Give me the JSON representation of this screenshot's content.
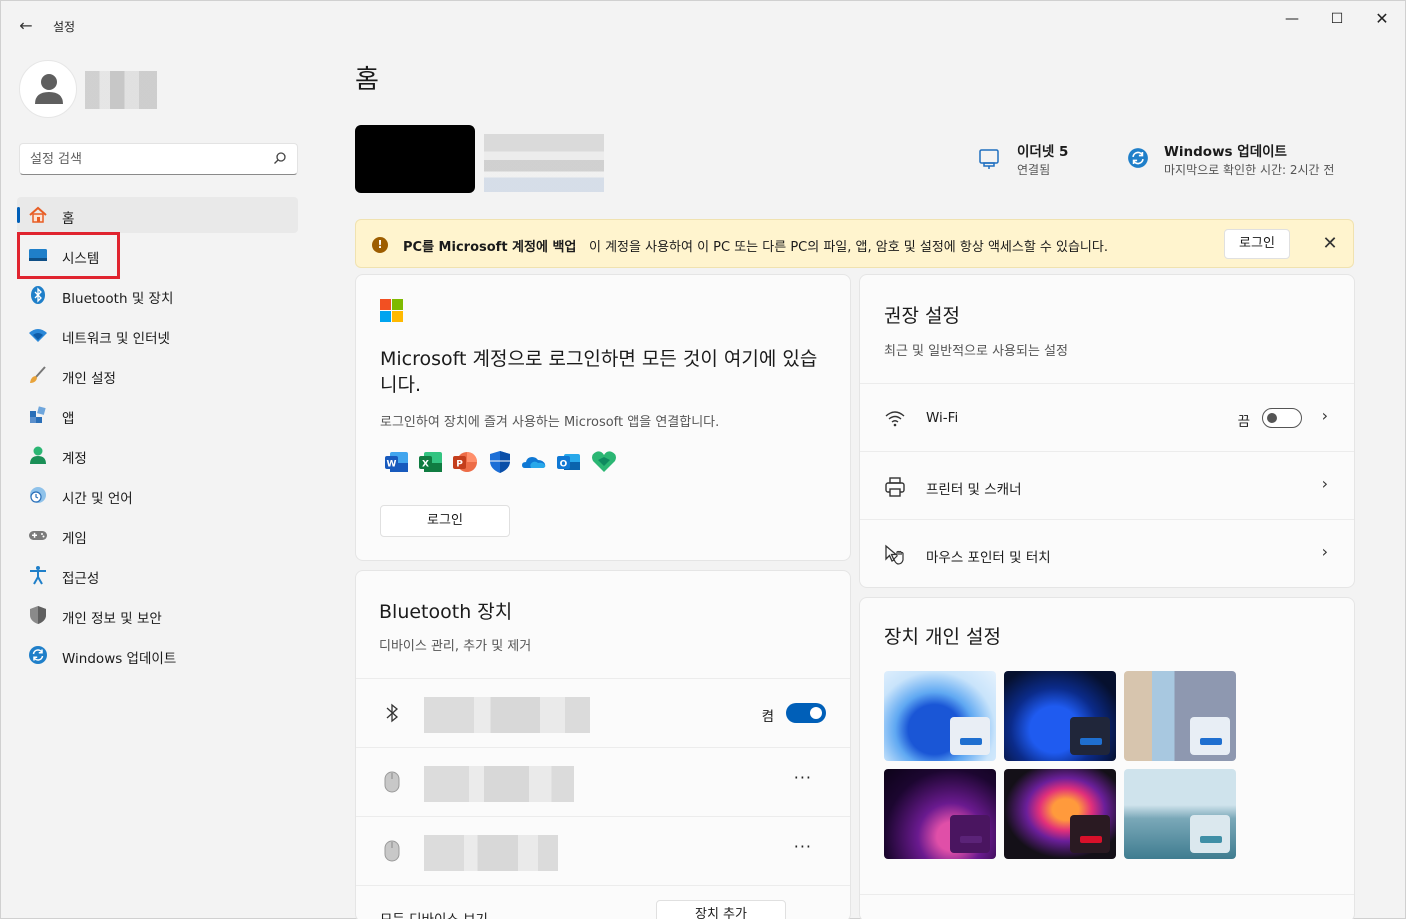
{
  "window": {
    "title": "설정",
    "back": "←",
    "minimize": "—",
    "maximize": "☐",
    "close": "✕"
  },
  "sidebar": {
    "search_placeholder": "설정 검색",
    "items": [
      {
        "label": "홈",
        "icon": "home-icon",
        "active": true
      },
      {
        "label": "시스템",
        "icon": "system-icon",
        "active": false
      },
      {
        "label": "Bluetooth 및 장치",
        "icon": "bluetooth-icon",
        "active": false
      },
      {
        "label": "네트워크 및 인터넷",
        "icon": "network-icon",
        "active": false
      },
      {
        "label": "개인 설정",
        "icon": "brush-icon",
        "active": false
      },
      {
        "label": "앱",
        "icon": "apps-icon",
        "active": false
      },
      {
        "label": "계정",
        "icon": "account-icon",
        "active": false
      },
      {
        "label": "시간 및 언어",
        "icon": "time-language-icon",
        "active": false
      },
      {
        "label": "게임",
        "icon": "gamepad-icon",
        "active": false
      },
      {
        "label": "접근성",
        "icon": "accessibility-icon",
        "active": false
      },
      {
        "label": "개인 정보 및 보안",
        "icon": "shield-icon",
        "active": false
      },
      {
        "label": "Windows 업데이트",
        "icon": "update-icon",
        "active": false
      }
    ]
  },
  "main": {
    "title": "홈",
    "status": {
      "ethernet_title": "이더넷 5",
      "ethernet_sub": "연결됨",
      "update_title": "Windows 업데이트",
      "update_sub": "마지막으로 확인한 시간: 2시간 전"
    },
    "banner": {
      "icon": "!",
      "title": "PC를 Microsoft 계정에 백업",
      "text": "이 계정을 사용하여 이 PC 또는 다른 PC의 파일, 앱, 암호 및 설정에 항상 액세스할 수 있습니다.",
      "button": "로그인",
      "close": "✕"
    },
    "signin_card": {
      "title": "Microsoft 계정으로 로그인하면 모든 것이 여기에 있습니다.",
      "desc": "로그인하여 장치에 즐겨 사용하는 Microsoft 앱을 연결합니다.",
      "apps": [
        "word-icon",
        "excel-icon",
        "powerpoint-icon",
        "defender-icon",
        "onedrive-icon",
        "outlook-icon",
        "family-icon"
      ],
      "button": "로그인"
    },
    "recommended": {
      "title": "권장 설정",
      "subtitle": "최근 및 일반적으로 사용되는 설정",
      "items": [
        {
          "label": "Wi-Fi",
          "icon": "wifi-icon",
          "toggle_label": "끔",
          "toggle_on": false
        },
        {
          "label": "프린터 및 스캐너",
          "icon": "printer-icon"
        },
        {
          "label": "마우스 포인터 및 터치",
          "icon": "pointer-icon"
        }
      ],
      "chevron": "›"
    },
    "bluetooth_card": {
      "title": "Bluetooth 장치",
      "subtitle": "디바이스 관리, 추가 및 제거",
      "toggle_label": "켬",
      "more": "···",
      "footer_label": "모든 디바이스 보기",
      "footer_button": "장치 추가"
    },
    "personalize": {
      "title": "장치 개인 설정"
    }
  },
  "colors": {
    "accent": "#005fb8",
    "highlight": "#e0242f",
    "banner_bg": "#fff4ce"
  }
}
